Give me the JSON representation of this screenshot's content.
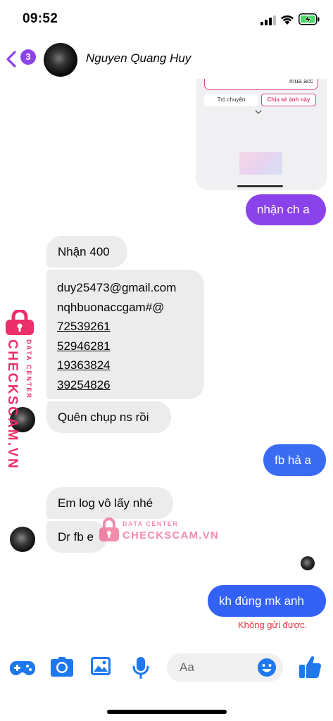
{
  "status_bar": {
    "time": "09:52"
  },
  "header": {
    "back_count": "3",
    "contact_name": "Nguyen Quang Huy"
  },
  "shared_image": {
    "card_text": "mua acc",
    "button_chat": "Trò chuyện",
    "button_share": "Chia sẻ ảnh này"
  },
  "messages": {
    "m1": "nhận ch a",
    "m2": "Nhận 400",
    "m3_lines": [
      "duy25473@gmail.com",
      "nqhbuonaccgam#@",
      "72539261",
      "52946281",
      "19363824",
      "39254826"
    ],
    "m4": "Quên chụp ns rồi",
    "m5": "fb hả a",
    "m6": "Em log vô lấy nhé",
    "m7": "Dr fb e",
    "m8": "kh đúng mk anh"
  },
  "send_error": "Không gửi được.",
  "watermark": {
    "main": "CHECKSCAM.VN",
    "sub": "DATA CENTER"
  },
  "composer": {
    "placeholder": "Aa"
  },
  "colors": {
    "accent_purple": "#8a43ea",
    "accent_blue": "#3461f5",
    "icon_blue": "#1e78ef",
    "incoming_bubble": "#ececec",
    "error_red": "#e5323a",
    "watermark_pink": "#ec2f6a"
  },
  "icons": [
    "back-chevron-icon",
    "cellular-signal-icon",
    "wifi-icon",
    "battery-charging-icon",
    "gamepad-icon",
    "camera-icon",
    "image-icon",
    "microphone-icon",
    "emoji-icon",
    "thumbs-up-icon",
    "lock-icon"
  ]
}
